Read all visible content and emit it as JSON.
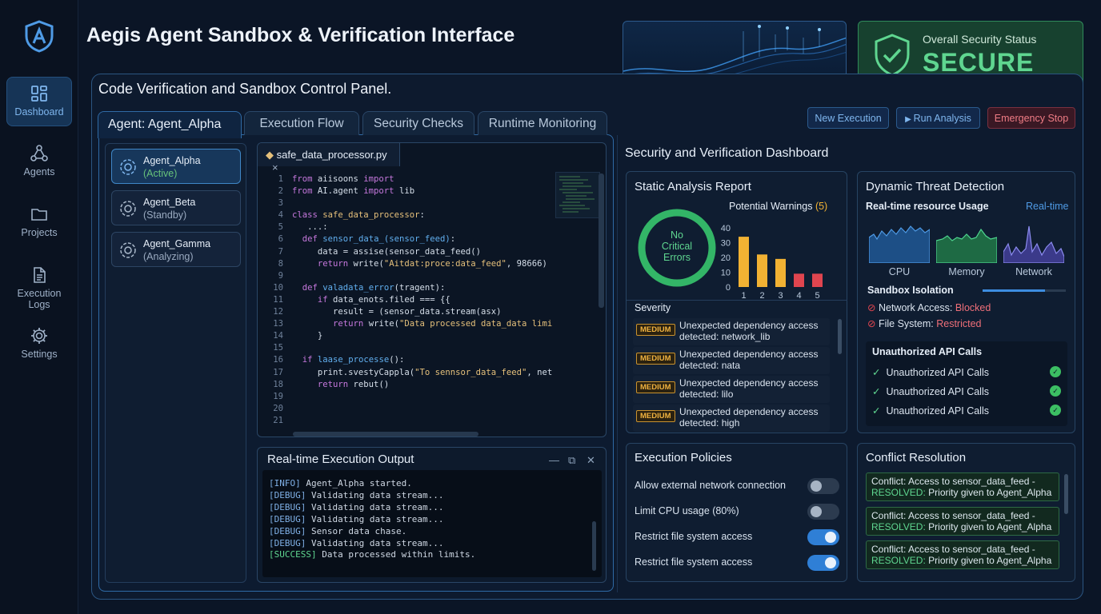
{
  "app": {
    "title": "Aegis Agent Sandbox & Verification Interface"
  },
  "sidebar": {
    "items": [
      {
        "label": "Dashboard",
        "icon": "dashboard-icon"
      },
      {
        "label": "Agents",
        "icon": "agents-icon"
      },
      {
        "label": "Projects",
        "icon": "folder-icon"
      },
      {
        "label": "Execution Logs",
        "icon": "document-icon"
      },
      {
        "label": "Settings",
        "icon": "gear-icon"
      }
    ]
  },
  "status": {
    "label": "Overall Security Status",
    "value": "SECURE",
    "color": "#5fd690"
  },
  "panel": {
    "title": "Code Verification and Sandbox Control Panel.",
    "agent_tab": "Agent: Agent_Alpha",
    "tabs": [
      "Execution Flow",
      "Security Checks",
      "Runtime Monitoring"
    ],
    "buttons": {
      "new_execution": "New Execution",
      "run_analysis": "Run Analysis",
      "emergency_stop": "Emergency Stop"
    }
  },
  "agents": [
    {
      "name": "Agent_Alpha",
      "status": "(Active)"
    },
    {
      "name": "Agent_Beta",
      "status": "(Standby)"
    },
    {
      "name": "Agent_Gamma",
      "status": "(Analyzing)"
    }
  ],
  "editor": {
    "filename": "safe_data_processor.py",
    "line_numbers": [
      "1",
      "2",
      "3",
      "4",
      "5",
      "6",
      "7",
      "8",
      "9",
      "10",
      "11",
      "12",
      "13",
      "14",
      "15",
      "16",
      "17",
      "18",
      "19",
      "20",
      "21"
    ]
  },
  "output": {
    "title": "Real-time Execution Output",
    "lines": [
      {
        "tag": "[INFO]",
        "text": " Agent_Alpha started."
      },
      {
        "tag": "[DEBUG]",
        "text": " Validating data stream..."
      },
      {
        "tag": "[DEBUG]",
        "text": " Validating data stream..."
      },
      {
        "tag": "[DEBUG]",
        "text": " Validating data stream..."
      },
      {
        "tag": "[DEBUG]",
        "text": " Sensor data chase."
      },
      {
        "tag": "[DEBUG]",
        "text": " Validating data stream..."
      },
      {
        "tag": "[SUCCESS]",
        "text": " Data processed within limits."
      }
    ]
  },
  "dashboard": {
    "title": "Security and Verification Dashboard",
    "static_analysis": {
      "title": "Static Analysis Report",
      "ring_text": [
        "No",
        "Critical",
        "Errors"
      ],
      "warnings_label": "Potential Warnings",
      "warnings_count": "(5)",
      "severity_label": "Severity",
      "issues": [
        {
          "level": "MEDIUM",
          "text": "Unexpected dependency access detected: network_lib"
        },
        {
          "level": "MEDIUM",
          "text": "Unexpected dependency access detected: nata"
        },
        {
          "level": "MEDIUM",
          "text": "Unexpected dependency access detected: lilo"
        },
        {
          "level": "MEDIUM",
          "text": "Unexpected dependency access detected: high"
        }
      ]
    },
    "threat": {
      "title": "Dynamic Threat Detection",
      "usage_label": "Real-time resource Usage",
      "realtime": "Real-time",
      "metrics": [
        "CPU",
        "Memory",
        "Network"
      ],
      "isolation_label": "Sandbox Isolation",
      "network_label": "Network Access: ",
      "network_value": "Blocked",
      "fs_label": "File System: ",
      "fs_value": "Restricted",
      "api_title": "Unauthorized API Calls",
      "api_rows": [
        "Unauthorized API Calls",
        "Unauthorized API Calls",
        "Unauthorized API Calls"
      ]
    },
    "policies": {
      "title": "Execution Policies",
      "items": [
        {
          "label": "Allow external network connection",
          "on": false
        },
        {
          "label": "Limit CPU usage (80%)",
          "on": false
        },
        {
          "label": "Restrict file system access",
          "on": true
        },
        {
          "label": "Restrict file system access",
          "on": true
        }
      ]
    },
    "conflict": {
      "title": "Conflict Resolution",
      "items": [
        {
          "line1": "Conflict: Access to sensor_data_feed -",
          "resolved": "RESOLVED:",
          "line2": " Priority given to Agent_Alpha"
        },
        {
          "line1": "Conflict: Access to sensor_data_feed -",
          "resolved": "RESOLVED:",
          "line2": " Priority given to Agent_Alpha"
        },
        {
          "line1": "Conflict: Access to sensor_data_feed -",
          "resolved": "RESOLVED:",
          "line2": " Priority given to Agent_Alpha"
        }
      ]
    }
  },
  "chart_data": {
    "type": "bar",
    "categories": [
      "1",
      "2",
      "3",
      "4",
      "5"
    ],
    "values": [
      34,
      22,
      19,
      9,
      9
    ],
    "ylim": [
      0,
      40
    ],
    "yticks": [
      "0",
      "10",
      "20",
      "30",
      "40"
    ],
    "colors": [
      "#f2b233",
      "#f2b233",
      "#f2b233",
      "#e0454f",
      "#e0454f"
    ]
  }
}
